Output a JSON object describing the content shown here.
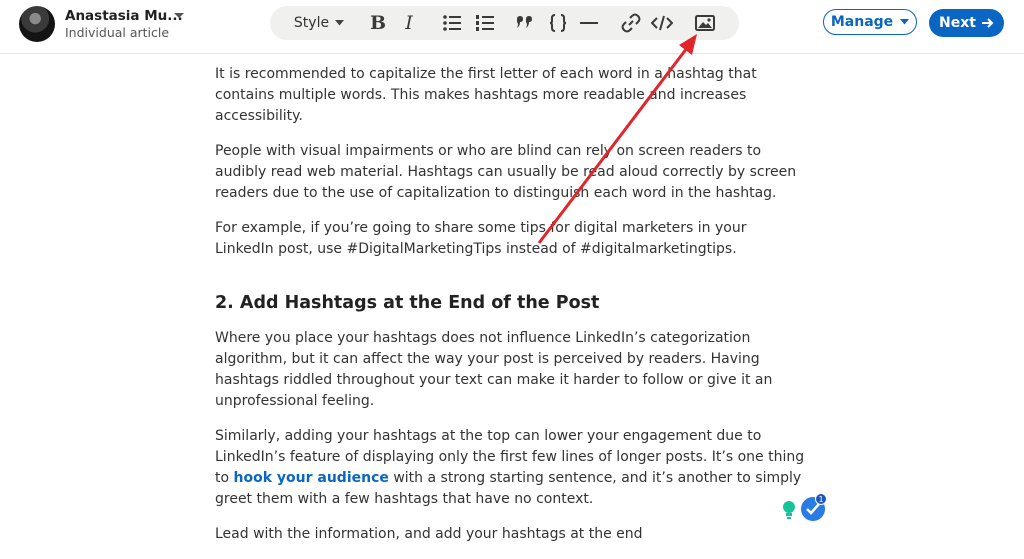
{
  "author": {
    "name": "Anastasia Mu...",
    "subtitle": "Individual article"
  },
  "toolbar": {
    "style_label": "Style",
    "bold_label": "B",
    "italic_label": "I",
    "icons": [
      "bulleted-list-icon",
      "numbered-list-icon",
      "quote-icon",
      "code-block-icon",
      "divider-icon",
      "link-icon",
      "code-icon",
      "image-icon"
    ]
  },
  "actions": {
    "manage_label": "Manage",
    "next_label": "Next"
  },
  "article": {
    "p1": "It is recommended to capitalize the first letter of each word in a hashtag that contains multiple words. This makes hashtags more readable and increases accessibility.",
    "p2": "People with visual impairments or who are blind can rely on screen readers to audibly read web material. Hashtags can usually be read aloud correctly by screen readers due to the use of capitalization to distinguish each word in the hashtag.",
    "p3": "For example, if you’re going to share some tips for digital marketers in your LinkedIn post, use #DigitalMarketingTips instead of #digitalmarketingtips.",
    "heading": "2. Add Hashtags at the End of the Post",
    "p4": "Where you place your hashtags does not influence LinkedIn’s categorization algorithm, but it can affect the way your post is perceived by readers. Having hashtags riddled throughout your text can make it harder to follow or give it an unprofessional feeling.",
    "p5_before": "Similarly, adding your hashtags at the top can lower your engagement due to LinkedIn’s feature of displaying only the first few lines of longer posts. It’s one thing to ",
    "p5_link": "hook your audience",
    "p5_after": " with a strong starting sentence, and it’s another to simply greet them with a few hashtags that have no context.",
    "p6": "Lead with the information, and add your hashtags at the end"
  },
  "assistant": {
    "badge_count": "1"
  },
  "colors": {
    "accent": "#0a66c2",
    "annotation_arrow": "#e0262b",
    "toolbar_bg": "#f0f0ee"
  }
}
